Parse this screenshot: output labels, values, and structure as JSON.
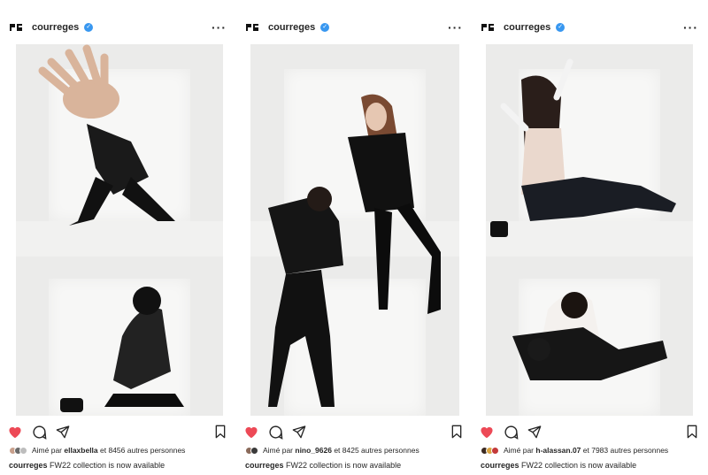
{
  "posts": [
    {
      "username": "courreges",
      "liked_by_prefix": "Aimé par ",
      "liked_by_user": "ellaxbella",
      "liked_by_suffix": " et 8456 autres personnes",
      "caption_user": "courreges",
      "caption_text": " FW22 collection is now available",
      "liked": true
    },
    {
      "username": "courreges",
      "liked_by_prefix": "Aimé par ",
      "liked_by_user": "nino_9626",
      "liked_by_suffix": " et 8425 autres personnes",
      "caption_user": "courreges",
      "caption_text": " FW22 collection is now available",
      "liked": true
    },
    {
      "username": "courreges",
      "liked_by_prefix": "Aimé par ",
      "liked_by_user": "h-alassan.07",
      "liked_by_suffix": " et 7983 autres personnes",
      "caption_user": "courreges",
      "caption_text": " FW22 collection is now available",
      "liked": true
    }
  ],
  "icons": {
    "verified": "verified-badge-icon",
    "more": "more-options-icon",
    "like": "heart-icon",
    "comment": "comment-icon",
    "share": "send-icon",
    "save": "bookmark-icon"
  },
  "colors": {
    "like": "#ed4956",
    "verified": "#3897f0",
    "text": "#262626"
  }
}
